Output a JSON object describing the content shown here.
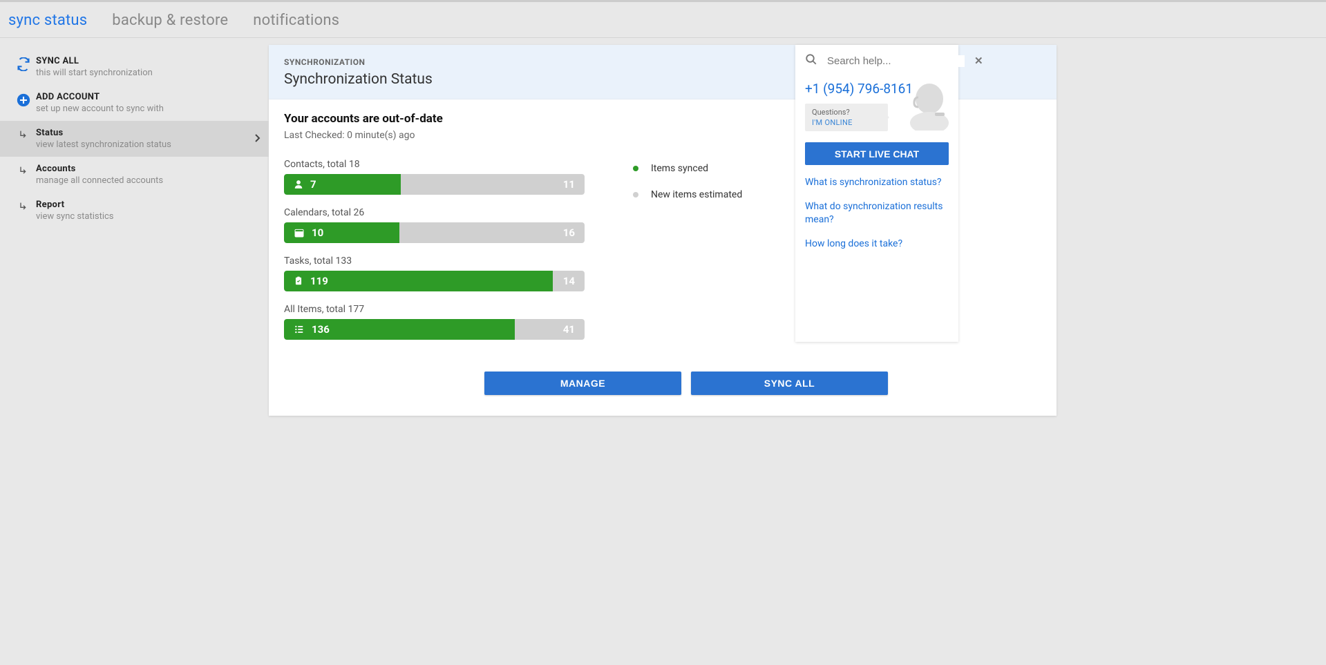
{
  "tabs": {
    "sync": "sync status",
    "backup": "backup & restore",
    "notifications": "notifications"
  },
  "sidebar": {
    "syncAll": {
      "title": "SYNC ALL",
      "sub": "this will start synchronization"
    },
    "addAccount": {
      "title": "ADD ACCOUNT",
      "sub": "set up new account to sync with"
    },
    "status": {
      "title": "Status",
      "sub": "view latest synchronization status"
    },
    "accounts": {
      "title": "Accounts",
      "sub": "manage all connected accounts"
    },
    "report": {
      "title": "Report",
      "sub": "view sync statistics"
    }
  },
  "card": {
    "overline": "SYNCHRONIZATION",
    "title": "Synchronization Status",
    "statusTitle": "Your accounts are out-of-date",
    "statusSub": "Last Checked: 0 minute(s) ago"
  },
  "legend": {
    "synced": "Items synced",
    "new": "New items estimated"
  },
  "buttons": {
    "manage": "MANAGE",
    "syncAll": "SYNC ALL"
  },
  "help": {
    "placeholder": "Search help...",
    "phone": "+1 (954) 796-8161",
    "q1": "Questions?",
    "q2": "I'M ONLINE",
    "chat": "START LIVE CHAT",
    "link1": "What is synchronization status?",
    "link2": "What do synchronization results mean?",
    "link3": "How long does it take?"
  },
  "chart_data": [
    {
      "name": "Contacts",
      "label": "Contacts, total 18",
      "synced": 7,
      "new": 11,
      "total": 18,
      "icon": "person"
    },
    {
      "name": "Calendars",
      "label": "Calendars, total 26",
      "synced": 10,
      "new": 16,
      "total": 26,
      "icon": "calendar"
    },
    {
      "name": "Tasks",
      "label": "Tasks, total 133",
      "synced": 119,
      "new": 14,
      "total": 133,
      "icon": "clipboard"
    },
    {
      "name": "All Items",
      "label": "All Items, total 177",
      "synced": 136,
      "new": 41,
      "total": 177,
      "icon": "list"
    }
  ]
}
